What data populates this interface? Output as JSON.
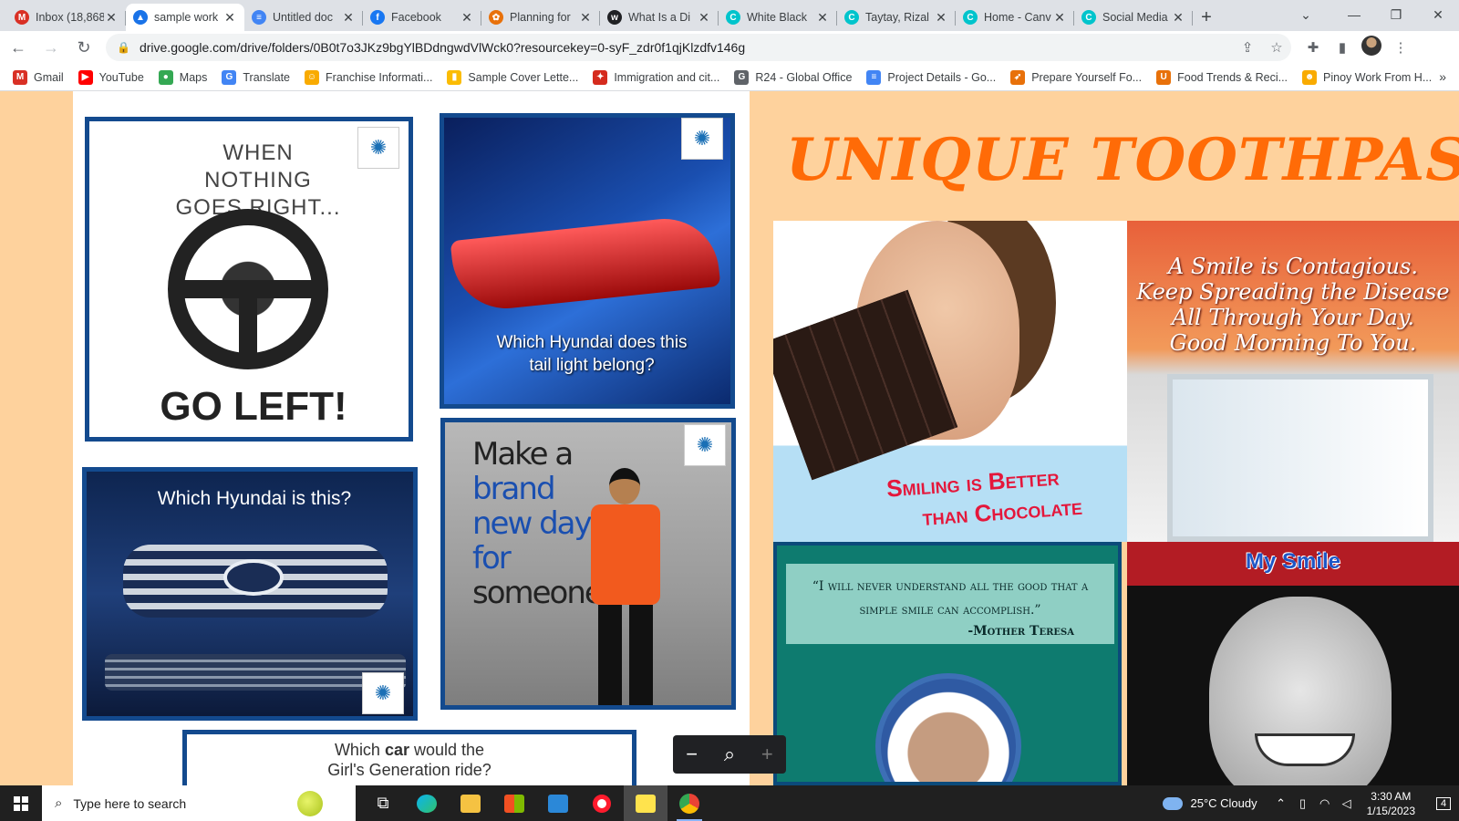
{
  "tabs": [
    {
      "title": "Inbox (18,868)",
      "icon": "gmail-icon",
      "color": "#d93025",
      "glyph": "M",
      "active": false
    },
    {
      "title": "sample work",
      "icon": "google-drive-icon",
      "color": "#1a73e8",
      "glyph": "▲",
      "active": true
    },
    {
      "title": "Untitled doc",
      "icon": "google-docs-icon",
      "color": "#4285f4",
      "glyph": "≡",
      "active": false
    },
    {
      "title": "Facebook",
      "icon": "facebook-icon",
      "color": "#1877f2",
      "glyph": "f",
      "active": false
    },
    {
      "title": "Planning for",
      "icon": "planning-icon",
      "color": "#e8710a",
      "glyph": "✿",
      "active": false
    },
    {
      "title": "What Is a Di",
      "icon": "site-icon",
      "color": "#202124",
      "glyph": "w",
      "active": false
    },
    {
      "title": "White Black",
      "icon": "canva-icon",
      "color": "#00c4cc",
      "glyph": "C",
      "active": false
    },
    {
      "title": "Taytay, Rizal",
      "icon": "canva-icon",
      "color": "#00c4cc",
      "glyph": "C",
      "active": false
    },
    {
      "title": "Home - Canv",
      "icon": "canva-icon",
      "color": "#00c4cc",
      "glyph": "C",
      "active": false
    },
    {
      "title": "Social Media",
      "icon": "canva-icon",
      "color": "#00c4cc",
      "glyph": "C",
      "active": false
    }
  ],
  "address": {
    "url": "drive.google.com/drive/folders/0B0t7o3JKz9bgYlBDdngwdVlWck0?resourcekey=0-syF_zdr0f1qjKlzdfv146g"
  },
  "bookmarks": [
    {
      "label": "Gmail",
      "icon": "gmail-icon",
      "color": "#d93025",
      "glyph": "M"
    },
    {
      "label": "YouTube",
      "icon": "youtube-icon",
      "color": "#ff0000",
      "glyph": "▶"
    },
    {
      "label": "Maps",
      "icon": "maps-icon",
      "color": "#34a853",
      "glyph": "●"
    },
    {
      "label": "Translate",
      "icon": "translate-icon",
      "color": "#4285f4",
      "glyph": "G"
    },
    {
      "label": "Franchise Informati...",
      "icon": "franchise-icon",
      "color": "#f9ab00",
      "glyph": "☺"
    },
    {
      "label": "Sample Cover Lette...",
      "icon": "cover-letter-icon",
      "color": "#fbbc04",
      "glyph": "▮"
    },
    {
      "label": "Immigration and cit...",
      "icon": "maple-leaf-icon",
      "color": "#d52b1e",
      "glyph": "✦"
    },
    {
      "label": "R24 - Global Office",
      "icon": "google-g-icon",
      "color": "#5f6368",
      "glyph": "G"
    },
    {
      "label": "Project Details - Go...",
      "icon": "google-forms-icon",
      "color": "#4285f4",
      "glyph": "≡"
    },
    {
      "label": "Prepare Yourself Fo...",
      "icon": "rocket-icon",
      "color": "#e8710a",
      "glyph": "➶"
    },
    {
      "label": "Food Trends & Reci...",
      "icon": "food-icon",
      "color": "#e8710a",
      "glyph": "U"
    },
    {
      "label": "Pinoy Work From H...",
      "icon": "worker-icon",
      "color": "#f9ab00",
      "glyph": "☻"
    }
  ],
  "viewer": {
    "left_cards": {
      "card1_top": "WHEN NOTHING GOES RIGHT...",
      "card1_bottom": "GO LEFT!",
      "card2_caption": "Which Hyundai does this tail light belong?",
      "card3_caption": "Which Hyundai is this?",
      "card4_brand_1": "Make a",
      "card4_brand_2": "brand",
      "card4_brand_3": "new day",
      "card4_brand_4": "for",
      "card4_brand_5": "someone!",
      "card5_caption_a": "Which ",
      "card5_caption_b": "car",
      "card5_caption_c": " would the",
      "card5_caption_d": "Girl's Generation ride?"
    },
    "right": {
      "title": "UNIQUE TOOTHPAST",
      "slogan_line1": "Smiling is Better",
      "slogan_line2": "than Chocolate",
      "quote_line1": "A Smile is Contagious.",
      "quote_line2": "Keep Spreading the Disease",
      "quote_line3": "All Through Your Day.",
      "quote_line4": "Good Morning To You.",
      "teresa_quote": "“I will never understand all the good that a simple smile can accomplish.”",
      "teresa_author": "-Mother Teresa",
      "my_smile": "My Smile"
    }
  },
  "taskbar": {
    "search_placeholder": "Type here to search",
    "weather": "25°C  Cloudy",
    "time": "3:30 AM",
    "date": "1/15/2023",
    "notifications": "4"
  }
}
